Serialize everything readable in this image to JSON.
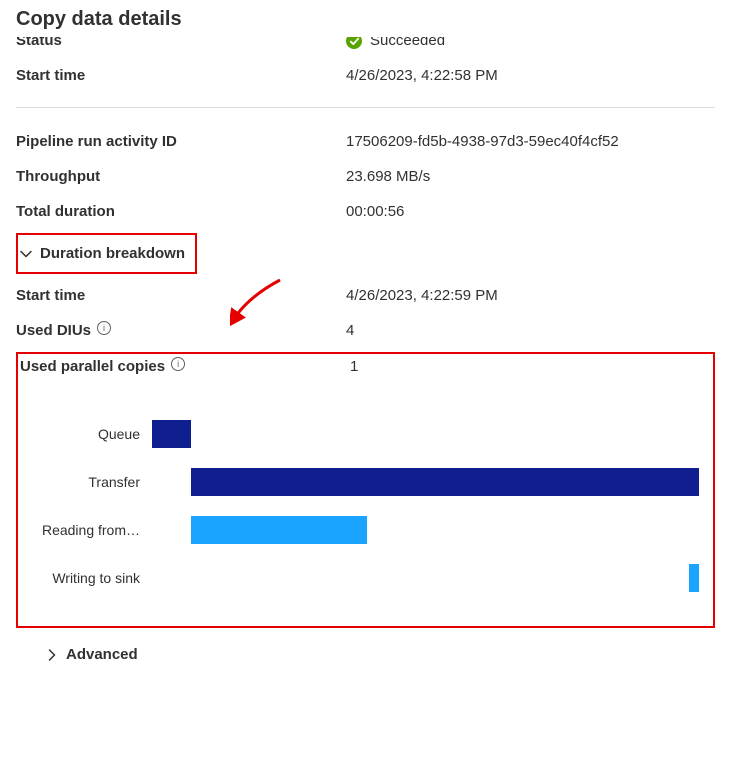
{
  "title": "Copy data details",
  "status_label": "Status",
  "status_value": "Succeeded",
  "start_time_label": "Start time",
  "start_time_value": "4/26/2023, 4:22:58 PM",
  "pipeline_id_label": "Pipeline run activity ID",
  "pipeline_id_value": "17506209-fd5b-4938-97d3-59ec40f4cf52",
  "throughput_label": "Throughput",
  "throughput_value": "23.698 MB/s",
  "total_duration_label": "Total duration",
  "total_duration_value": "00:00:56",
  "duration_breakdown_label": "Duration breakdown",
  "breakdown_start_label": "Start time",
  "breakdown_start_value": "4/26/2023, 4:22:59 PM",
  "used_dius_label": "Used DIUs",
  "used_dius_value": "4",
  "used_parallel_label": "Used parallel copies",
  "used_parallel_value": "1",
  "advanced_label": "Advanced",
  "chart_data": {
    "type": "bar",
    "xlabel": "",
    "ylabel": "",
    "ylim": [
      0,
      56
    ],
    "series": [
      {
        "name": "Queue",
        "start": 0,
        "duration": 4,
        "color": "#0f1f8f"
      },
      {
        "name": "Transfer",
        "start": 4,
        "duration": 52,
        "color": "#0f1f8f"
      },
      {
        "name": "Reading from…",
        "start": 4,
        "duration": 18,
        "color": "#1aa3ff"
      },
      {
        "name": "Writing to sink",
        "start": 55,
        "duration": 1,
        "color": "#1aa3ff"
      }
    ]
  }
}
